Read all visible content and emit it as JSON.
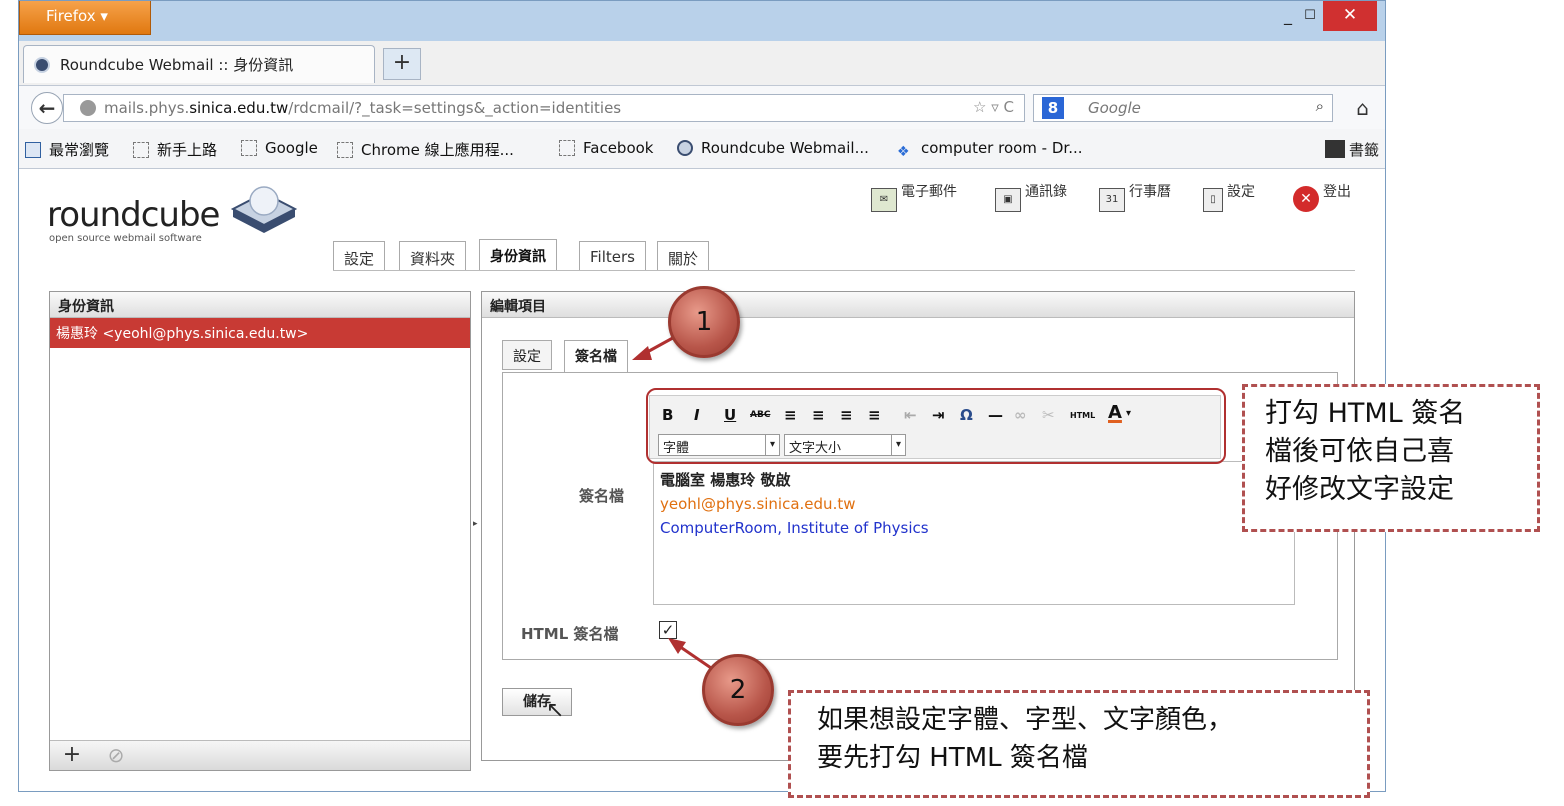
{
  "browser": {
    "menu_label": "Firefox",
    "minimize": "_",
    "maximize": "☐",
    "close": "✕",
    "tab_title": "Roundcube Webmail :: 身份資訊",
    "new_tab": "+"
  },
  "nav": {
    "url_prefix": "mails.phys.",
    "url_domain": "sinica.edu.tw",
    "url_path": "/rdcmail/?_task=settings&_action=identities",
    "url_tools": "☆ ▿ C",
    "search_engine": "8",
    "search_placeholder": "Google"
  },
  "bookmarks": [
    "最常瀏覽",
    "新手上路",
    "Google",
    "Chrome 線上應用程...",
    "Facebook",
    "Roundcube Webmail...",
    "computer room - Dr..."
  ],
  "bookmarks_right": "書籤",
  "app": {
    "logo": "roundcube",
    "logo_sub": "open source webmail software",
    "topnav": {
      "mail": "電子郵件",
      "contacts": "通訊錄",
      "calendar": "行事曆",
      "settings": "設定",
      "logout": "登出"
    },
    "tabs": [
      "設定",
      "資料夾",
      "身份資訊",
      "Filters",
      "關於"
    ],
    "left_header": "身份資訊",
    "identity": "楊惠玲 <yeohl@phys.sinica.edu.tw>",
    "right_header": "編輯項目",
    "inner_tabs": [
      "設定",
      "簽名檔"
    ],
    "toolbar": {
      "bold": "B",
      "italic": "I",
      "underline": "U",
      "strike": "ABC",
      "font_select": "字體",
      "size_select": "文字大小",
      "html": "HTML",
      "color": "A"
    },
    "sig_label": "簽名檔",
    "sig_lines": [
      "電腦室 楊惠玲 敬啟",
      "yeohl@phys.sinica.edu.tw",
      "ComputerRoom, Institute of Physics"
    ],
    "html_sig_label": "HTML 簽名檔",
    "save": "儲存",
    "add": "+",
    "disable": "⊘"
  },
  "annotations": {
    "step1": "1",
    "step2": "2",
    "callout1": [
      "打勾 HTML 簽名",
      "檔後可依自己喜",
      "好修改文字設定"
    ],
    "callout2": [
      "如果想設定字體、字型、文字顏色，",
      "要先打勾 HTML 簽名檔"
    ]
  },
  "colors": {
    "accent_red": "#c83a34",
    "sig_orange": "#e07010",
    "sig_blue": "#2233cc"
  }
}
